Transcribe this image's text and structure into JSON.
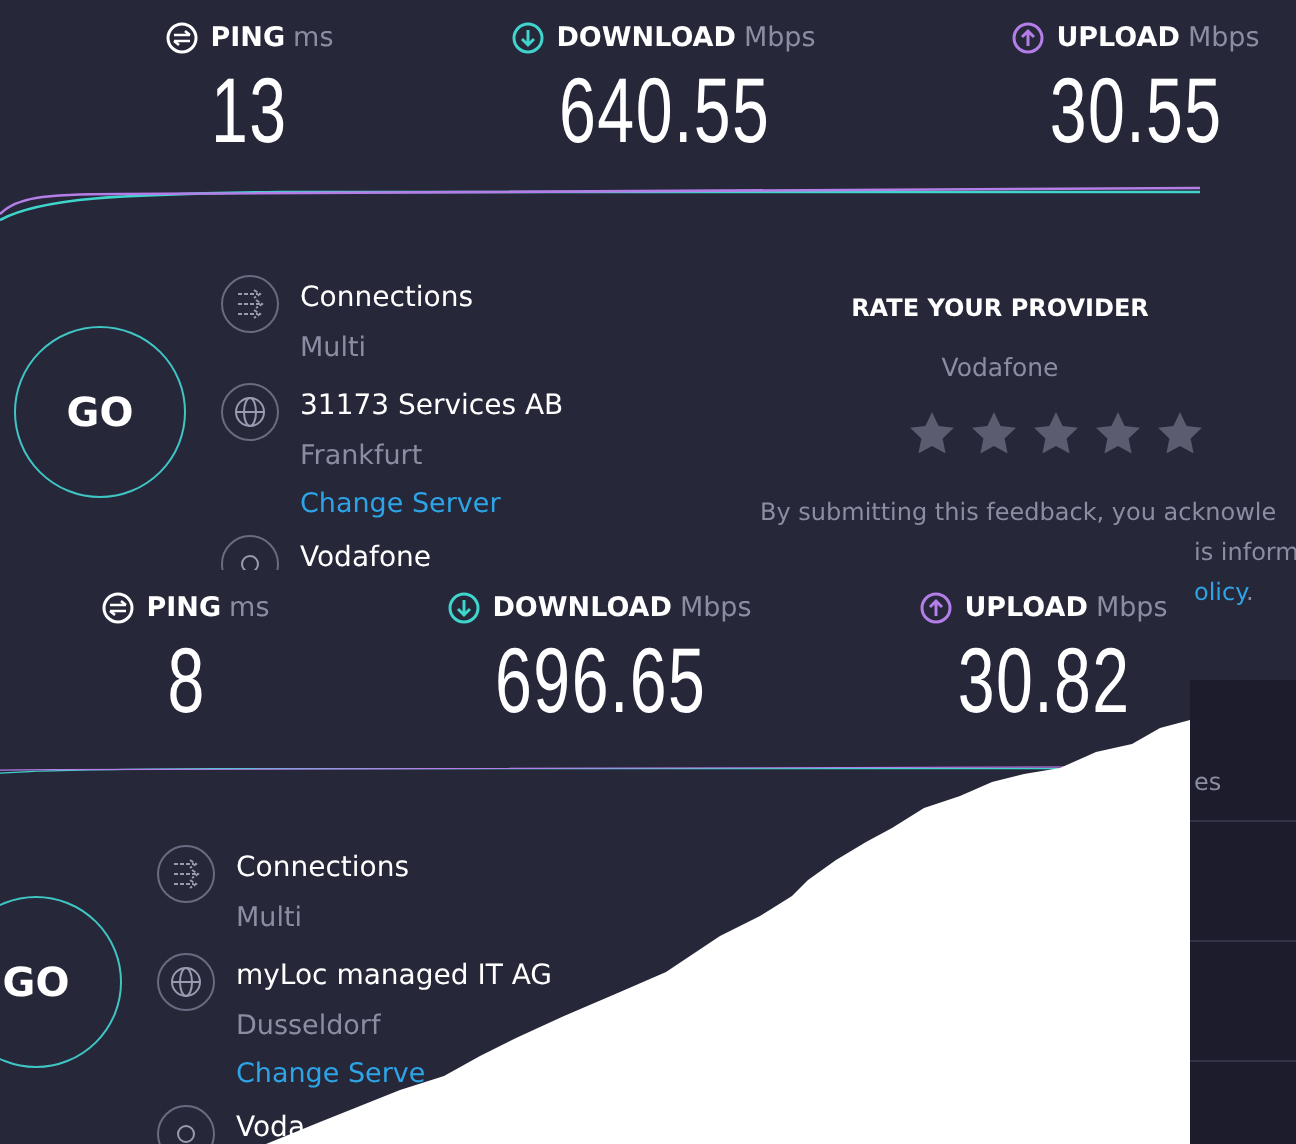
{
  "results": [
    {
      "metrics": [
        {
          "kind": "ping",
          "label": "PING",
          "unit": "ms",
          "value": "13"
        },
        {
          "kind": "download",
          "label": "DOWNLOAD",
          "unit": "Mbps",
          "value": "640.55"
        },
        {
          "kind": "upload",
          "label": "UPLOAD",
          "unit": "Mbps",
          "value": "30.55"
        }
      ],
      "go": "GO",
      "details": [
        {
          "kind": "connections",
          "title": "Connections",
          "subtitle": "Multi"
        },
        {
          "kind": "server",
          "title": "31173 Services AB",
          "subtitle": "Frankfurt",
          "link": "Change Server"
        },
        {
          "kind": "isp",
          "title": "Vodafone"
        }
      ],
      "rating": {
        "title": "RATE YOUR PROVIDER",
        "provider": "Vodafone",
        "stars": 0,
        "notice": [
          "By submitting this feedback, you acknowle",
          "is inform"
        ],
        "notice_link": "olicy",
        "notice_end": "."
      }
    },
    {
      "metrics": [
        {
          "kind": "ping",
          "label": "PING",
          "unit": "ms",
          "value": "8"
        },
        {
          "kind": "download",
          "label": "DOWNLOAD",
          "unit": "Mbps",
          "value": "696.65"
        },
        {
          "kind": "upload",
          "label": "UPLOAD",
          "unit": "Mbps",
          "value": "30.82"
        }
      ],
      "go": "GO",
      "details": [
        {
          "kind": "connections",
          "title": "Connections",
          "subtitle": "Multi"
        },
        {
          "kind": "server",
          "title": "myLoc managed IT AG",
          "subtitle": "Dusseldorf",
          "link": "Change Serve"
        },
        {
          "kind": "isp",
          "title": "Voda"
        }
      ]
    }
  ],
  "side_panel": {
    "text": "es"
  }
}
